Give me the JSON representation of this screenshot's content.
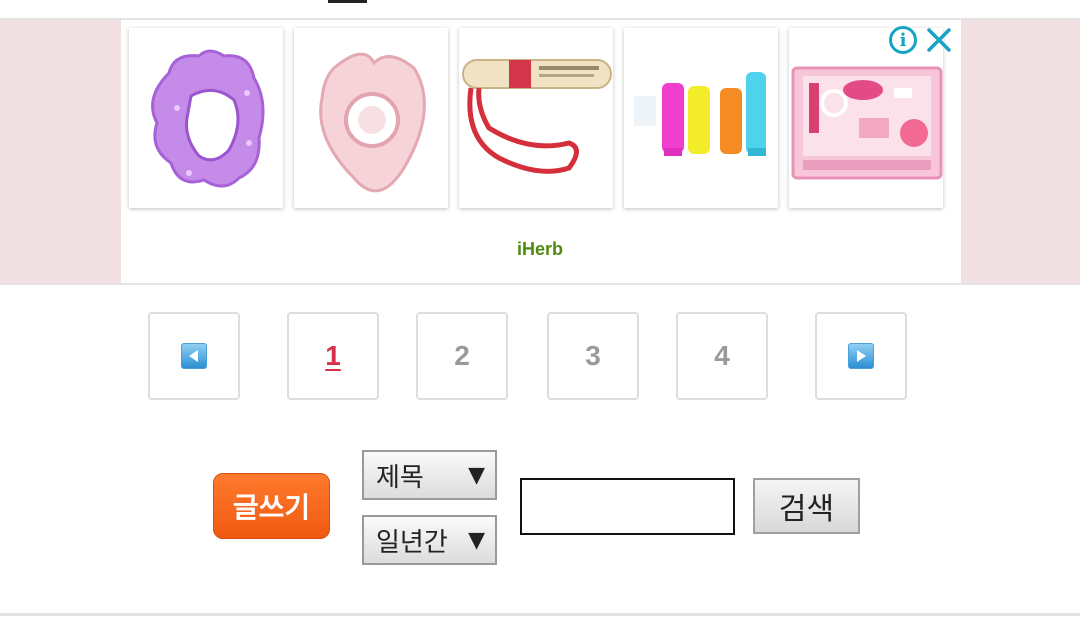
{
  "ad": {
    "brand": "iHerb",
    "info_icon": "info-icon",
    "close_icon": "close-icon",
    "products": [
      {
        "icon": "purple-teether-image"
      },
      {
        "icon": "pink-teether-image"
      },
      {
        "icon": "tube-with-lanyard-image"
      },
      {
        "icon": "colored-bottles-image"
      },
      {
        "icon": "pink-grooming-kit-image"
      }
    ]
  },
  "pagination": {
    "prev_icon": "left-arrow-icon",
    "next_icon": "right-arrow-icon",
    "pages": [
      "1",
      "2",
      "3",
      "4"
    ],
    "current": "1"
  },
  "actions": {
    "write_label": "글쓰기",
    "search_field_select": "제목",
    "period_select": "일년간",
    "select_caret": "▼",
    "search_query": "",
    "search_button": "검색"
  },
  "colors": {
    "ad_band": "#f0e0e1",
    "write_button": "#ef5a10",
    "current_page": "#d6304e",
    "brand_green": "#4f8a10",
    "icon_teal": "#17a4c4"
  }
}
